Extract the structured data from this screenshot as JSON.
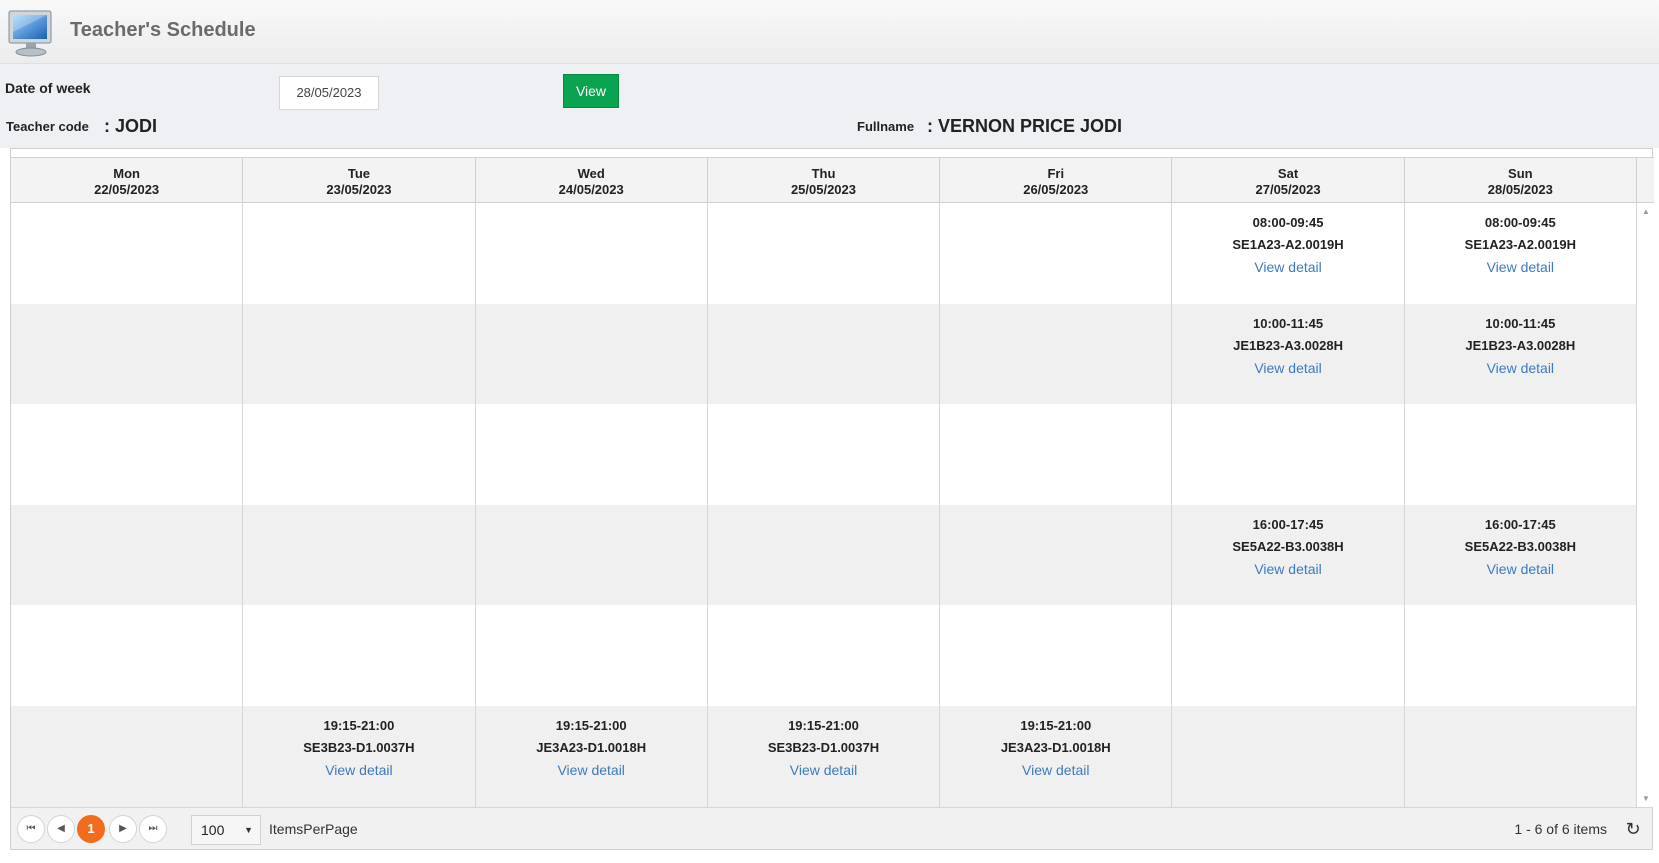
{
  "header": {
    "title": "Teacher's Schedule",
    "logo_icon": "computer-monitor-icon"
  },
  "filters": {
    "date_label": "Date of week",
    "date_value": "28/05/2023",
    "view_label": "View",
    "teacher_code_label": "Teacher code",
    "teacher_code_value": ": JODI",
    "fullname_label": "Fullname",
    "fullname_value": ": VERNON PRICE JODI"
  },
  "colors": {
    "accent_green": "#0aa34f",
    "pager_active": "#f26c1d",
    "link": "#3b7bbf"
  },
  "days": [
    {
      "day": "Mon",
      "date": "22/05/2023"
    },
    {
      "day": "Tue",
      "date": "23/05/2023"
    },
    {
      "day": "Wed",
      "date": "24/05/2023"
    },
    {
      "day": "Thu",
      "date": "25/05/2023"
    },
    {
      "day": "Fri",
      "date": "26/05/2023"
    },
    {
      "day": "Sat",
      "date": "27/05/2023"
    },
    {
      "day": "Sun",
      "date": "28/05/2023"
    }
  ],
  "detail_label": "View detail",
  "slots": [
    [
      null,
      null,
      null,
      null,
      null,
      {
        "time": "08:00-09:45",
        "code": "SE1A23-A2.0019H"
      },
      {
        "time": "08:00-09:45",
        "code": "SE1A23-A2.0019H"
      }
    ],
    [
      null,
      null,
      null,
      null,
      null,
      {
        "time": "10:00-11:45",
        "code": "JE1B23-A3.0028H"
      },
      {
        "time": "10:00-11:45",
        "code": "JE1B23-A3.0028H"
      }
    ],
    [
      null,
      null,
      null,
      null,
      null,
      null,
      null
    ],
    [
      null,
      null,
      null,
      null,
      null,
      {
        "time": "16:00-17:45",
        "code": "SE5A22-B3.0038H"
      },
      {
        "time": "16:00-17:45",
        "code": "SE5A22-B3.0038H"
      }
    ],
    [
      null,
      null,
      null,
      null,
      null,
      null,
      null
    ],
    [
      null,
      {
        "time": "19:15-21:00",
        "code": "SE3B23-D1.0037H"
      },
      {
        "time": "19:15-21:00",
        "code": "JE3A23-D1.0018H"
      },
      {
        "time": "19:15-21:00",
        "code": "SE3B23-D1.0037H"
      },
      {
        "time": "19:15-21:00",
        "code": "JE3A23-D1.0018H"
      },
      null,
      null
    ]
  ],
  "pager": {
    "current_page": "1",
    "items_per_page": "100",
    "items_per_page_label": "ItemsPerPage",
    "item_count": "1 - 6 of 6 items"
  }
}
